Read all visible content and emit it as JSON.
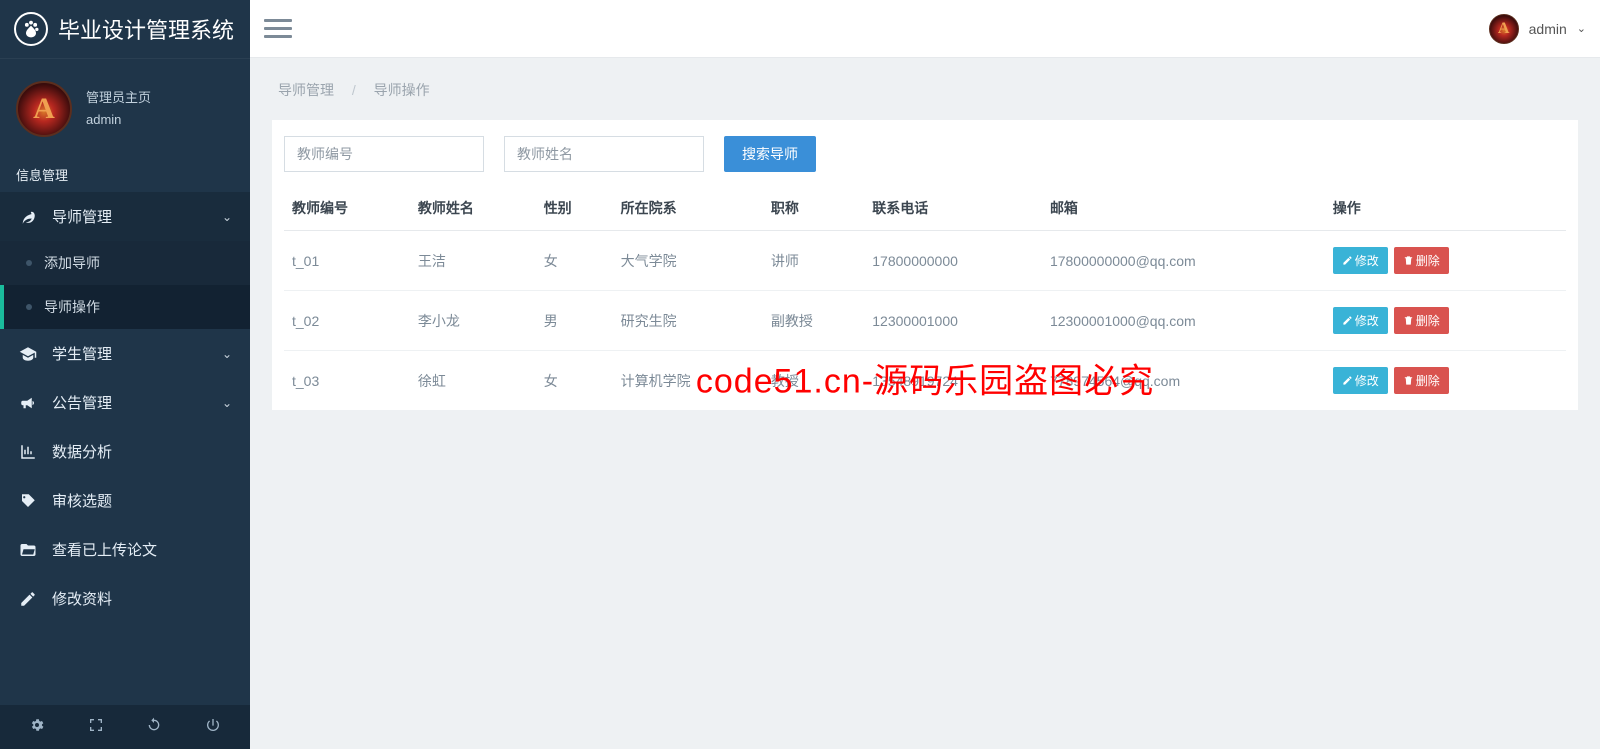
{
  "brand": {
    "title": "毕业设计管理系统"
  },
  "user": {
    "role": "管理员主页",
    "name": "admin",
    "avatar_letter": "A"
  },
  "sidebar": {
    "section": "信息管理",
    "items": [
      {
        "label": "导师管理",
        "expandable": true
      },
      {
        "label": "学生管理",
        "expandable": true
      },
      {
        "label": "公告管理",
        "expandable": true
      },
      {
        "label": "数据分析",
        "expandable": false
      },
      {
        "label": "审核选题",
        "expandable": false
      },
      {
        "label": "查看已上传论文",
        "expandable": false
      },
      {
        "label": "修改资料",
        "expandable": false
      }
    ],
    "sub_tutor": [
      {
        "label": "添加导师"
      },
      {
        "label": "导师操作"
      }
    ]
  },
  "topbar": {
    "username": "admin"
  },
  "breadcrumb": {
    "a": "导师管理",
    "b": "导师操作"
  },
  "search": {
    "id_placeholder": "教师编号",
    "name_placeholder": "教师姓名",
    "button": "搜索导师"
  },
  "table": {
    "headers": [
      "教师编号",
      "教师姓名",
      "性别",
      "所在院系",
      "职称",
      "联系电话",
      "邮箱",
      "操作"
    ],
    "rows": [
      {
        "id": "t_01",
        "name": "王洁",
        "gender": "女",
        "dept": "大气学院",
        "title": "讲师",
        "phone": "17800000000",
        "email": "17800000000@qq.com"
      },
      {
        "id": "t_02",
        "name": "李小龙",
        "gender": "男",
        "dept": "研究生院",
        "title": "副教授",
        "phone": "12300001000",
        "email": "12300001000@qq.com"
      },
      {
        "id": "t_03",
        "name": "徐虹",
        "gender": "女",
        "dept": "计算机学院",
        "title": "教授",
        "phone": "13548919724",
        "email": "778974564@qq.com"
      }
    ],
    "edit_label": "修改",
    "delete_label": "删除"
  },
  "watermark": "code51.cn-源码乐园盗图必究"
}
